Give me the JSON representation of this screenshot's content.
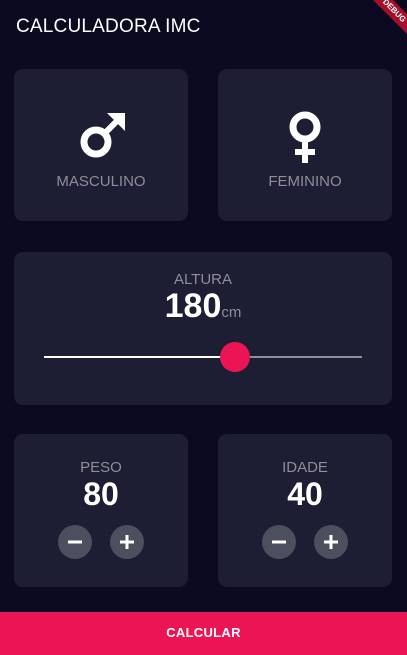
{
  "appbar": {
    "title": "CALCULADORA IMC",
    "debug_banner": "DEBUG"
  },
  "gender": {
    "male_label": "MASCULINO",
    "female_label": "FEMININO"
  },
  "height": {
    "label": "ALTURA",
    "value": "180",
    "unit": "cm",
    "slider_fraction": 0.6
  },
  "weight": {
    "label": "PESO",
    "value": "80"
  },
  "age": {
    "label": "IDADE",
    "value": "40"
  },
  "calculate_button": "CALCULAR",
  "colors": {
    "background": "#0b0a21",
    "card": "#1d1e33",
    "accent": "#eb1555",
    "muted_text": "#8d8e98",
    "round_button": "#4c4f5e"
  },
  "icons": {
    "male": "mars-icon",
    "female": "venus-icon",
    "minus": "minus-icon",
    "plus": "plus-icon"
  }
}
